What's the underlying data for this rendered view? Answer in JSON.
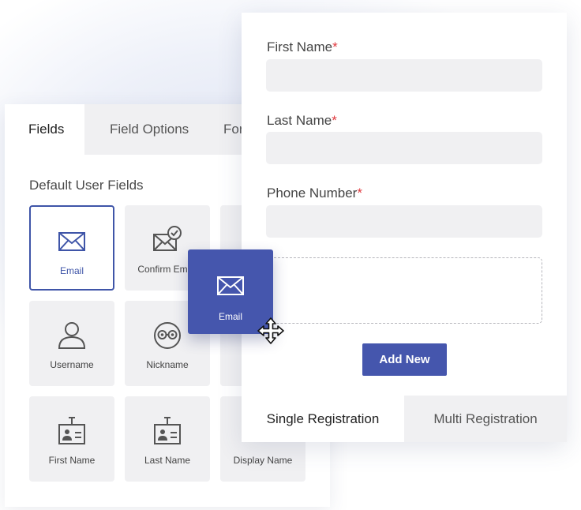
{
  "builder": {
    "tabs": [
      {
        "label": "Fields",
        "active": true
      },
      {
        "label": "Field Options",
        "active": false
      },
      {
        "label": "Form Settings",
        "active": false
      }
    ],
    "section_title": "Default User Fields",
    "fields": [
      {
        "label": "Email",
        "icon": "envelope-icon",
        "selected": true
      },
      {
        "label": "Confirm Email",
        "icon": "envelope-check-icon",
        "selected": false
      },
      {
        "label": "Username",
        "icon": "user-icon",
        "selected": false
      },
      {
        "label": "Nickname",
        "icon": "glasses-face-icon",
        "selected": false
      },
      {
        "label": "First Name",
        "icon": "id-badge-icon",
        "selected": false
      },
      {
        "label": "Last Name",
        "icon": "id-badge-icon",
        "selected": false
      },
      {
        "label": "Display Name",
        "icon": "id-badge-icon",
        "selected": false
      }
    ]
  },
  "drag": {
    "label": "Email",
    "icon": "envelope-icon",
    "cursor": "move-cursor-icon"
  },
  "form": {
    "fields": [
      {
        "label": "First Name",
        "required_mark": "*"
      },
      {
        "label": "Last Name",
        "required_mark": "*"
      },
      {
        "label": "Phone Number",
        "required_mark": "*"
      }
    ],
    "add_button": "Add New",
    "bottom_tabs": [
      {
        "label": "Single Registration",
        "active": true
      },
      {
        "label": "Multi Registration",
        "active": false
      }
    ]
  },
  "colors": {
    "accent": "#4556ad",
    "required": "#e0393e",
    "field_bg": "#f0f0f2"
  }
}
